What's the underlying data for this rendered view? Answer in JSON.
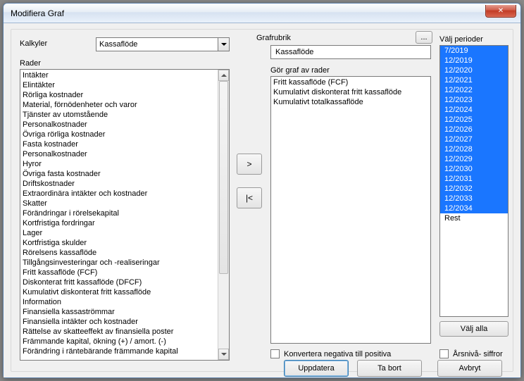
{
  "window": {
    "title": "Modifiera Graf"
  },
  "labels": {
    "kalkyler": "Kalkyler",
    "rader": "Rader",
    "grafrubrik": "Grafrubrik",
    "gor_graf": "Gör graf av rader",
    "valj_perioder": "Välj perioder"
  },
  "kalkyler_combo": {
    "value": "Kassaflöde"
  },
  "grafrubrik_input": {
    "value": "Kassaflöde"
  },
  "dots_button": "...",
  "rader_items": [
    "Intäkter",
    "Elintäkter",
    "Rörliga kostnader",
    "Material, förnödenheter och varor",
    "Tjänster av utomstående",
    "Personalkostnader",
    "Övriga rörliga kostnader",
    "Fasta kostnader",
    "Personalkostnader",
    "Hyror",
    "Övriga fasta kostnader",
    "Driftskostnader",
    "Extraordinära intäkter och kostnader",
    "Skatter",
    "Förändringar i rörelsekapital",
    "Kortfristiga fordringar",
    "Lager",
    "Kortfristiga skulder",
    "Rörelsens kassaflöde",
    "Tillgångsinvesteringar och -realiseringar",
    "Fritt kassaflöde (FCF)",
    "Diskonterat fritt kassaflöde (DFCF)",
    "Kumulativt diskonterat fritt kassaflöde",
    "Information",
    "Finansiella kassaströmmar",
    "Finansiella intäkter och kostnader",
    "Rättelse av skatteeffekt av finansiella poster",
    "Främmande kapital, ökning (+) / amort. (-)",
    "Förändring i räntebärande främmande kapital"
  ],
  "graf_items": [
    "Fritt kassaflöde (FCF)",
    "Kumulativt diskonterat fritt kassaflöde",
    "Kumulativt totalkassaflöde"
  ],
  "transfer": {
    "add": ">",
    "remove": "|<"
  },
  "periods": {
    "selected": [
      "7/2019",
      "12/2019",
      "12/2020",
      "12/2021",
      "12/2022",
      "12/2023",
      "12/2024",
      "12/2025",
      "12/2026",
      "12/2027",
      "12/2028",
      "12/2029",
      "12/2030",
      "12/2031",
      "12/2032",
      "12/2033",
      "12/2034"
    ],
    "other": [
      "Rest"
    ]
  },
  "buttons": {
    "valj_alla": "Välj alla",
    "uppdatera": "Uppdatera",
    "ta_bort": "Ta bort",
    "avbryt": "Avbryt"
  },
  "checkboxes": {
    "konvertera": "Konvertera negativa till positiva",
    "arsniva": "Årsnivå- siffror"
  }
}
